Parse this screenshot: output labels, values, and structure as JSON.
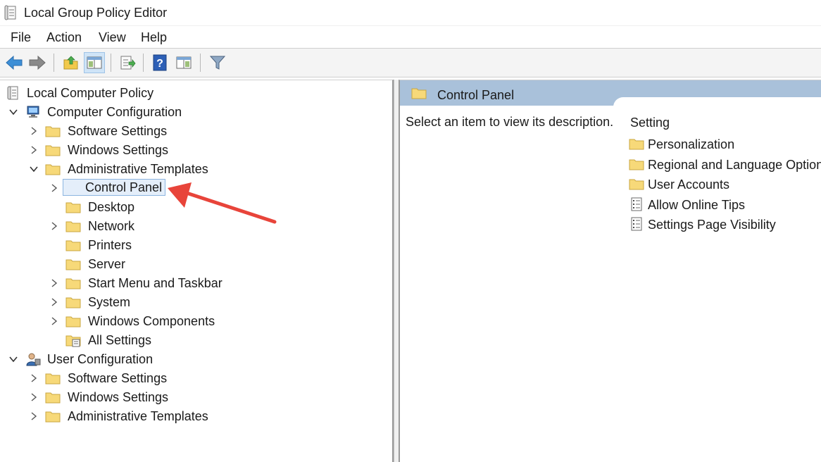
{
  "window": {
    "title": "Local Group Policy Editor"
  },
  "menu": {
    "items": [
      "File",
      "Action",
      "View",
      "Help"
    ]
  },
  "toolbar": {
    "buttons": [
      "back-arrow",
      "forward-arrow",
      "up-folder",
      "show-hide-console-tree",
      "export-list",
      "help",
      "show-action-pane",
      "filter"
    ]
  },
  "tree": {
    "root": "Local Computer Policy",
    "computer_config": {
      "label": "Computer Configuration",
      "software_settings": "Software Settings",
      "windows_settings": "Windows Settings",
      "admin_templates": {
        "label": "Administrative Templates",
        "children": [
          "Control Panel",
          "Desktop",
          "Network",
          "Printers",
          "Server",
          "Start Menu and Taskbar",
          "System",
          "Windows Components",
          "All Settings"
        ]
      }
    },
    "user_config": {
      "label": "User Configuration",
      "software_settings": "Software Settings",
      "windows_settings": "Windows Settings",
      "admin_templates": "Administrative Templates"
    },
    "selected": "Control Panel"
  },
  "details": {
    "header": "Control Panel",
    "description": "Select an item to view its description.",
    "column_setting": "Setting",
    "items": [
      {
        "label": "Personalization",
        "icon": "folder-icon"
      },
      {
        "label": "Regional and Language Options",
        "icon": "folder-icon"
      },
      {
        "label": "User Accounts",
        "icon": "folder-icon"
      },
      {
        "label": "Allow Online Tips",
        "icon": "policy-setting-icon"
      },
      {
        "label": "Settings Page Visibility",
        "icon": "policy-setting-icon"
      }
    ]
  },
  "colors": {
    "accent_header": "#a9c1da",
    "selection": "#e4eefa",
    "annotation_arrow": "#e8443a",
    "folder": "#f7d979"
  }
}
